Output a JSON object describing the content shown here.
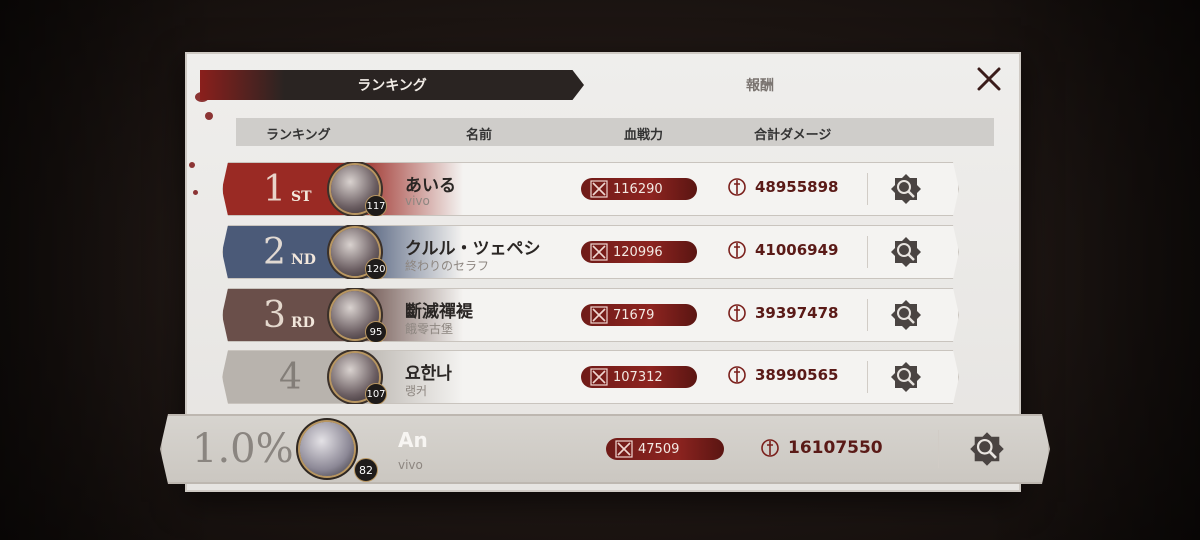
{
  "tabs": [
    {
      "label": "ランキング",
      "active": true
    },
    {
      "label": "報酬",
      "active": false
    }
  ],
  "table_header": {
    "rank": "ランキング",
    "name": "名前",
    "power": "血戦力",
    "damage": "合計ダメージ"
  },
  "rows": [
    {
      "rank": "1",
      "suffix": "ST",
      "plate_color": "#9a2a24",
      "name": "あいる",
      "guild": "vivo",
      "level": "117",
      "power": "116290",
      "damage": "48955898"
    },
    {
      "rank": "2",
      "suffix": "ND",
      "plate_color": "#4b5a78",
      "name": "クルル・ツェペシ",
      "guild": "終わりのセラフ",
      "level": "120",
      "power": "120996",
      "damage": "41006949"
    },
    {
      "rank": "3",
      "suffix": "RD",
      "plate_color": "#6a4f4a",
      "name": "斷滅禪褆",
      "guild": "餓零古堡",
      "level": "95",
      "power": "71679",
      "damage": "39397478"
    },
    {
      "rank": "4",
      "suffix": "",
      "plate_color": "#b8b3ad",
      "name": "요한나",
      "guild": "랭커",
      "level": "107",
      "power": "107312",
      "damage": "38990565"
    }
  ],
  "self": {
    "rank": "1.0%",
    "name": "An",
    "guild": "vivo",
    "level": "82",
    "power": "47509",
    "damage": "16107550"
  },
  "icons": {
    "close": "close-icon",
    "power": "crossed-swords-icon",
    "damage": "sword-emblem-icon",
    "detail": "magnifier-icon"
  },
  "colors": {
    "accent_red": "#8a1f1c",
    "damage_text": "#5a1a17"
  }
}
